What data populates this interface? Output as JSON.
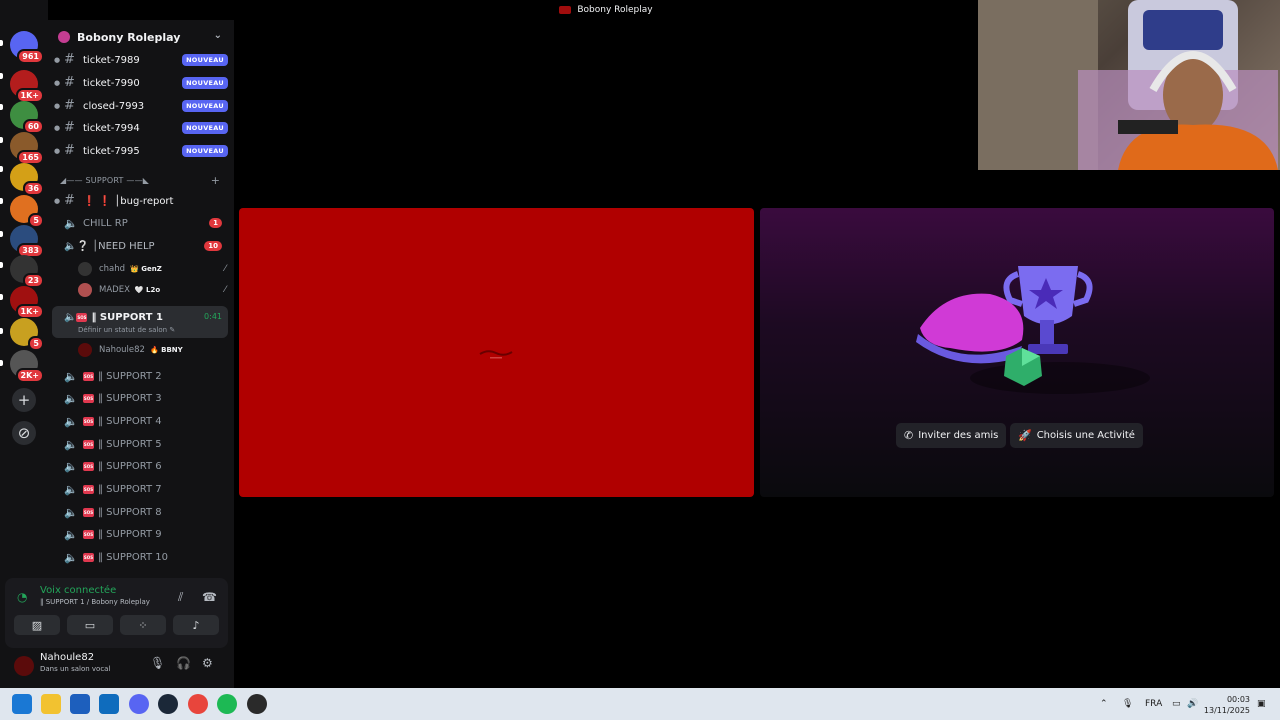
{
  "window": {
    "title": "Bobony Roleplay"
  },
  "rail": {
    "servers": [
      {
        "badge": "961",
        "color": "#5865f2"
      },
      {
        "badge": "1K+",
        "color": "#b31d1d"
      },
      {
        "badge": "60",
        "color": "#3e8e41"
      },
      {
        "badge": "165",
        "color": "#8a5a2b"
      },
      {
        "badge": "36",
        "color": "#d4a017"
      },
      {
        "badge": "5",
        "color": "#e07020"
      },
      {
        "badge": "383",
        "color": "#2b4c7e"
      },
      {
        "badge": "23",
        "color": "#333"
      },
      {
        "badge": "1K+",
        "color": "#a01010"
      },
      {
        "badge": "5",
        "color": "#c8a020"
      },
      {
        "badge": "2K+",
        "color": "#555"
      }
    ],
    "add_icon": "plus-icon",
    "discover_icon": "compass-icon"
  },
  "sidebar": {
    "server_name": "Bobony Roleplay",
    "new_label": "NOUVEAU",
    "tickets": [
      "ticket-7989",
      "ticket-7990",
      "closed-7993",
      "ticket-7994",
      "ticket-7995"
    ],
    "category_support": "◢—— SUPPORT ——◣",
    "bug_report": "❗ ❗ │bug-report",
    "chill": {
      "name": "CHILL RP",
      "count": "1"
    },
    "need_help": {
      "name": "❔ │NEED HELP",
      "count": "10"
    },
    "need_help_users": [
      {
        "name": "chahd",
        "tag": "👑 GenZ"
      },
      {
        "name": "MADEX",
        "tag": "🤍 L2o"
      }
    ],
    "support1": {
      "name": "‖ SUPPORT 1",
      "time": "0:41",
      "status": "Définir un statut de salon ✎"
    },
    "support1_user": {
      "name": "Nahoule82",
      "tag": "🔥 BBNY"
    },
    "supports": [
      "‖ SUPPORT 2",
      "‖ SUPPORT 3",
      "‖ SUPPORT 4",
      "‖ SUPPORT 5",
      "‖ SUPPORT 6",
      "‖ SUPPORT 7",
      "‖ SUPPORT 8",
      "‖ SUPPORT 9",
      "‖ SUPPORT 10"
    ]
  },
  "voice_panel": {
    "status": "Voix connectée",
    "channel": "‖ SUPPORT 1 / Bobony Roleplay"
  },
  "user_panel": {
    "name": "Nahoule82",
    "status": "Dans un salon vocal"
  },
  "stage": {
    "invite_button": "Inviter des amis",
    "activity_button": "Choisis une Activité"
  },
  "taskbar": {
    "language": "FRA",
    "time": "00:03",
    "date": "13/11/2025"
  }
}
